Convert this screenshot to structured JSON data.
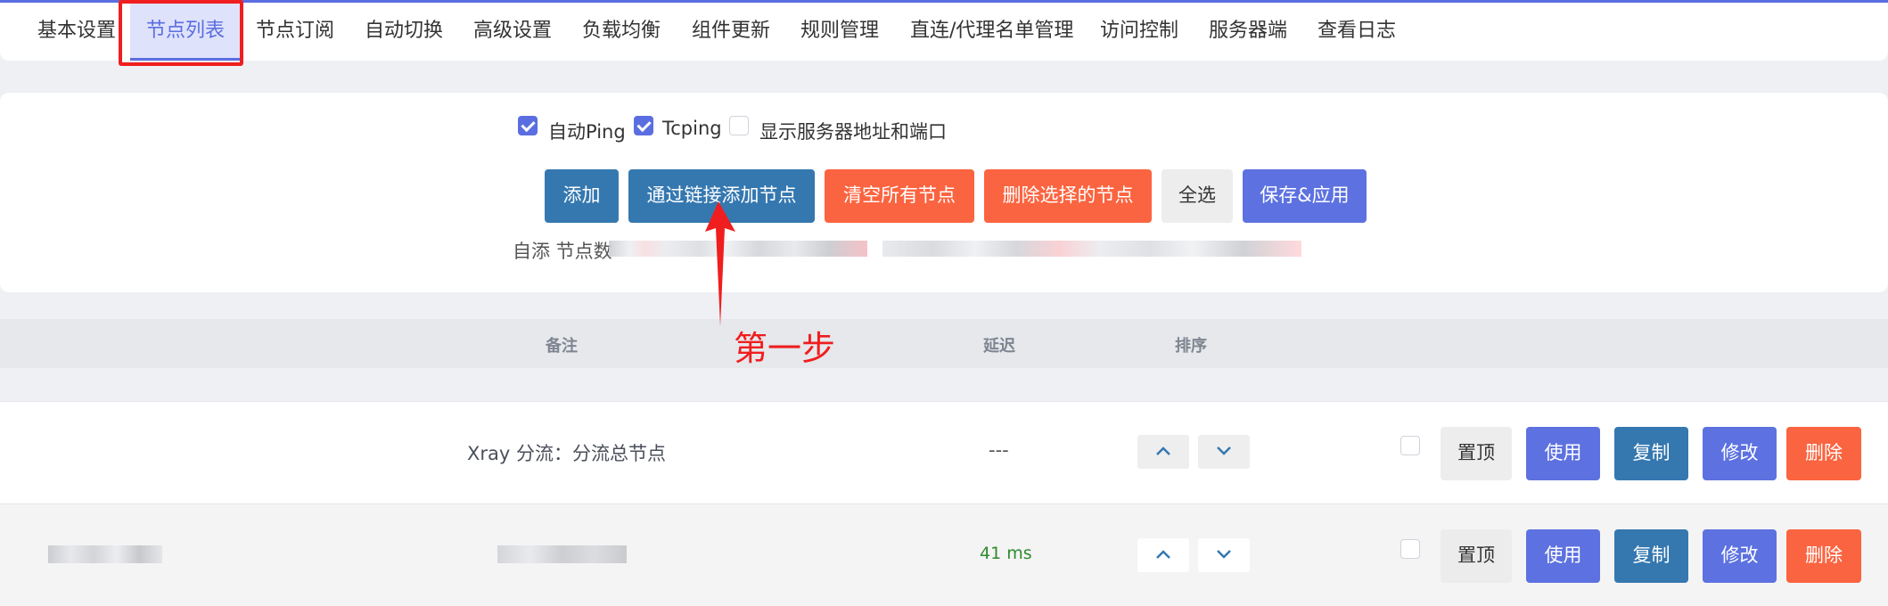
{
  "tabs": [
    "基本设置",
    "节点列表",
    "节点订阅",
    "自动切换",
    "高级设置",
    "负载均衡",
    "组件更新",
    "规则管理",
    "直连/代理名单管理",
    "访问控制",
    "服务器端",
    "查看日志"
  ],
  "options": {
    "auto_ping": {
      "label": "自动Ping",
      "checked": true
    },
    "tcping": {
      "label": "Tcping",
      "checked": true
    },
    "show_server": {
      "label": "显示服务器地址和端口",
      "checked": false
    }
  },
  "actions": {
    "add": "添加",
    "add_by_link": "通过链接添加节点",
    "clear_all": "清空所有节点",
    "delete_selected": "删除选择的节点",
    "select_all": "全选",
    "save_apply": "保存&应用"
  },
  "count_label": "自添 节点数",
  "annotation": "第一步",
  "table": {
    "headers": {
      "remark": "备注",
      "latency": "延迟",
      "order": "排序"
    },
    "rows": [
      {
        "remark": "Xray 分流：分流总节点",
        "latency": "---"
      },
      {
        "remark": "",
        "latency": "41 ms"
      }
    ],
    "row_actions": {
      "top": "置顶",
      "use": "使用",
      "copy": "复制",
      "edit": "修改",
      "delete": "删除"
    }
  },
  "colors": {
    "accent": "#5b6ee1",
    "blue": "#3578b0",
    "orange": "#fb6440",
    "latency_ok": "#2e8b2e",
    "annotation": "#f01e1e"
  }
}
